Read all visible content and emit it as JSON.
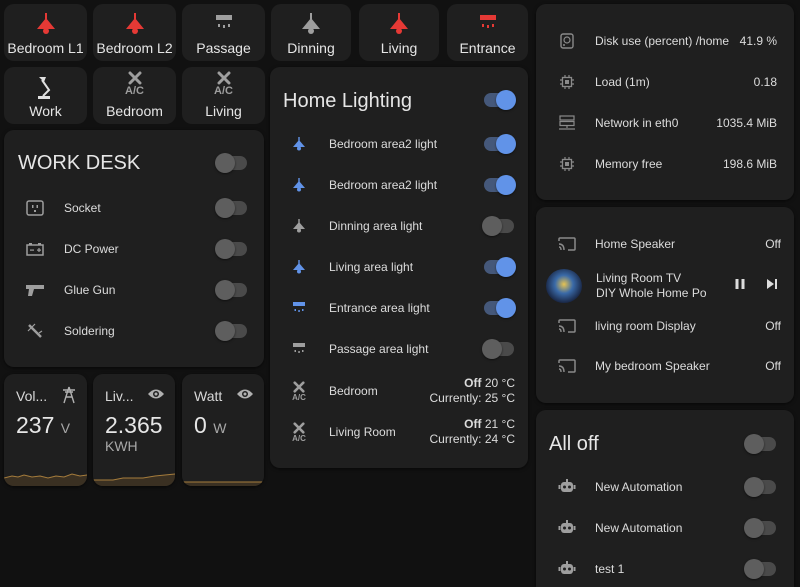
{
  "colors": {
    "accent": "#6193e8",
    "red": "#e53935",
    "grey": "#9e9e9e",
    "card": "#1f1f1f",
    "bg": "#111111",
    "spark": "#7a6238"
  },
  "tiles_row1": [
    {
      "label": "Bedroom L1",
      "icon": "ceiling-lamp-icon",
      "state": "on"
    },
    {
      "label": "Bedroom L2",
      "icon": "ceiling-lamp-icon",
      "state": "on"
    },
    {
      "label": "Passage",
      "icon": "ceiling-light-icon",
      "state": "off"
    },
    {
      "label": "Dinning",
      "icon": "ceiling-lamp-icon",
      "state": "off"
    },
    {
      "label": "Living",
      "icon": "ceiling-lamp-icon",
      "state": "on"
    },
    {
      "label": "Entrance",
      "icon": "ceiling-light-icon",
      "state": "on"
    }
  ],
  "tiles_row2": [
    {
      "label": "Work",
      "icon": "desk-lamp-icon"
    },
    {
      "label": "Bedroom",
      "icon": "air-conditioner-icon"
    },
    {
      "label": "Living",
      "icon": "air-conditioner-icon"
    }
  ],
  "ac_glyph": "A/C",
  "work_desk": {
    "title": "WORK DESK",
    "items": [
      {
        "label": "Socket",
        "icon": "socket-icon"
      },
      {
        "label": "DC Power",
        "icon": "battery-icon"
      },
      {
        "label": "Glue Gun",
        "icon": "glue-gun-icon"
      },
      {
        "label": "Soldering",
        "icon": "soldering-iron-icon"
      }
    ]
  },
  "sensors": [
    {
      "name": "Vol...",
      "value": "237",
      "unit": "V",
      "sub": "",
      "icon": "transmission-tower-icon"
    },
    {
      "name": "Liv...",
      "value": "2.365",
      "unit": "",
      "sub": "KWH",
      "icon": "eye-icon"
    },
    {
      "name": "Watt",
      "value": "0",
      "unit": "W",
      "sub": "",
      "icon": "eye-icon"
    }
  ],
  "home_lighting": {
    "title": "Home Lighting",
    "lights": [
      {
        "label": "Bedroom area2 light",
        "on": true
      },
      {
        "label": "Bedroom area2 light",
        "on": true
      },
      {
        "label": "Dinning area light",
        "on": false
      },
      {
        "label": "Living area light",
        "on": true
      },
      {
        "label": "Entrance area light",
        "on": true
      },
      {
        "label": "Passage area light",
        "on": false
      }
    ],
    "climate": [
      {
        "label": "Bedroom",
        "state": "Off",
        "target": "20 °C",
        "current": "Currently: 25 °C"
      },
      {
        "label": "Living Room",
        "state": "Off",
        "target": "21 °C",
        "current": "Currently: 24 °C"
      }
    ]
  },
  "system": [
    {
      "label": "Disk use (percent) /home",
      "value": "41.9 %",
      "icon": "harddisk-icon"
    },
    {
      "label": "Load (1m)",
      "value": "0.18",
      "icon": "cpu-icon"
    },
    {
      "label": "Network in eth0",
      "value": "1035.4 MiB",
      "icon": "server-network-icon"
    },
    {
      "label": "Memory free",
      "value": "198.6 MiB",
      "icon": "memory-icon"
    }
  ],
  "media": [
    {
      "label": "Home Speaker",
      "value": "Off",
      "icon": "cast-icon"
    },
    {
      "label": "Living Room TV",
      "sub": "DIY Whole Home Pov",
      "icon": "album-art"
    },
    {
      "label": "living room Display",
      "value": "Off",
      "icon": "cast-icon"
    },
    {
      "label": "My bedroom Speaker",
      "value": "Off",
      "icon": "cast-icon"
    }
  ],
  "automations": {
    "title": "All off",
    "items": [
      {
        "label": "New Automation"
      },
      {
        "label": "New Automation"
      },
      {
        "label": "test 1"
      }
    ]
  }
}
